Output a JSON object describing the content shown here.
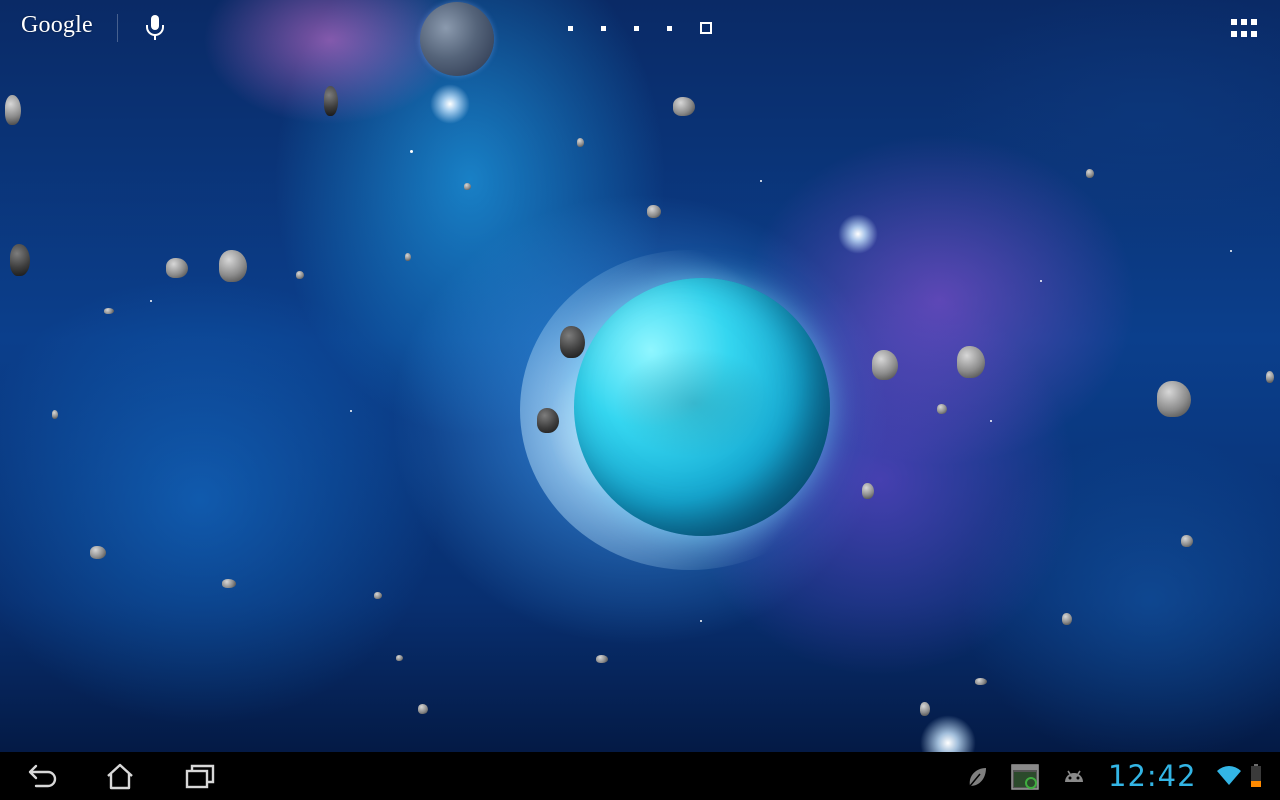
{
  "search_bar": {
    "brand_label": "Google",
    "mic_icon": "microphone-icon"
  },
  "home_screen": {
    "page_count": 5,
    "current_page": 5,
    "apps_icon": "all-apps-grid-icon"
  },
  "wallpaper": {
    "description_icon": "space-live-wallpaper",
    "colors": {
      "nebula_blue": "#0b3f8c",
      "planet_cyan": "#35d6f0",
      "nebula_purple": "#8a4fd8"
    }
  },
  "system_bar": {
    "nav": {
      "back_icon": "back-icon",
      "home_icon": "home-icon",
      "recents_icon": "recent-apps-icon"
    },
    "notifications": [
      {
        "icon": "leaf-notification-icon"
      },
      {
        "icon": "screenshot-notification-icon"
      },
      {
        "icon": "android-debug-icon"
      }
    ],
    "clock": "12:42",
    "wifi_icon": "wifi-icon",
    "battery_icon": "battery-icon",
    "colors": {
      "clock": "#33b5e5",
      "wifi": "#33b5e5",
      "battery_low": "#ff8a00"
    }
  }
}
